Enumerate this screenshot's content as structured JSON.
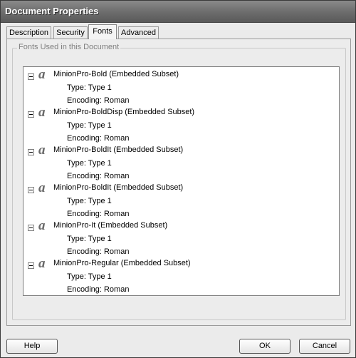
{
  "window": {
    "title": "Document Properties"
  },
  "tabs": [
    {
      "label": "Description",
      "active": false
    },
    {
      "label": "Security",
      "active": false
    },
    {
      "label": "Fonts",
      "active": true
    },
    {
      "label": "Advanced",
      "active": false
    }
  ],
  "fonts_panel": {
    "group_label": "Fonts Used in this Document",
    "fonts": [
      {
        "name": "MinionPro-Bold (Embedded Subset)",
        "type": "Type: Type 1",
        "encoding": "Encoding: Roman"
      },
      {
        "name": "MinionPro-BoldDisp (Embedded Subset)",
        "type": "Type: Type 1",
        "encoding": "Encoding: Roman"
      },
      {
        "name": "MinionPro-BoldIt (Embedded Subset)",
        "type": "Type: Type 1",
        "encoding": "Encoding: Roman"
      },
      {
        "name": "MinionPro-BoldIt (Embedded Subset)",
        "type": "Type: Type 1",
        "encoding": "Encoding: Roman"
      },
      {
        "name": "MinionPro-It (Embedded Subset)",
        "type": "Type: Type 1",
        "encoding": "Encoding: Roman"
      },
      {
        "name": "MinionPro-Regular (Embedded Subset)",
        "type": "Type: Type 1",
        "encoding": "Encoding: Roman"
      }
    ]
  },
  "buttons": {
    "help": "Help",
    "ok": "OK",
    "cancel": "Cancel"
  },
  "icons": {
    "font": "font-type-icon",
    "expander": "tree-collapse-icon"
  },
  "colors": {
    "titlebar": "#6e6e6e",
    "background": "#ebebeb"
  }
}
